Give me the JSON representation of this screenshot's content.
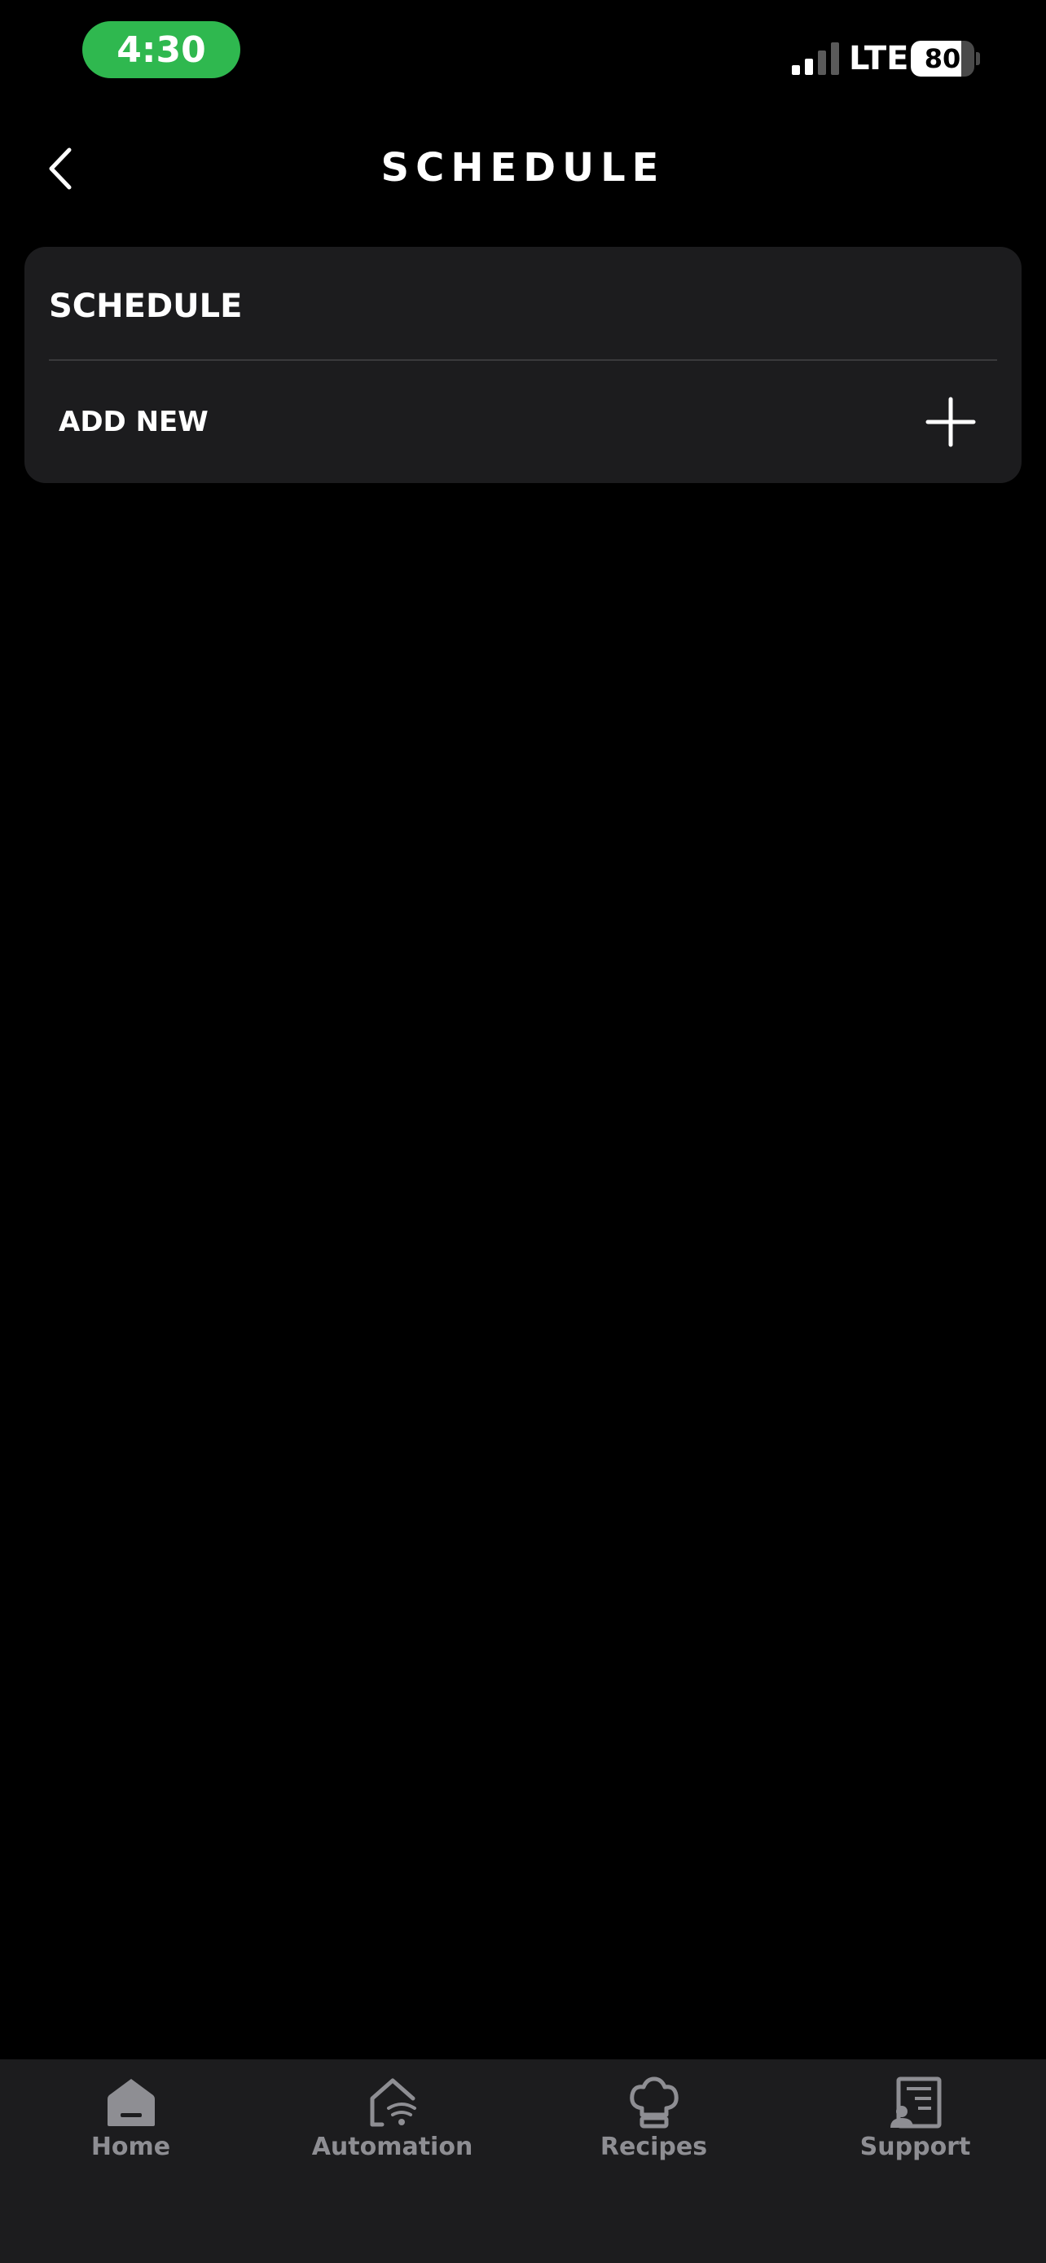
{
  "status_bar": {
    "time": "4:30",
    "carrier": "LTE",
    "battery_percent": 80,
    "battery_label": "80",
    "time_pill_color": "#2fb84f"
  },
  "header": {
    "title": "SCHEDULE",
    "back_icon": "chevron-left-icon"
  },
  "card": {
    "title": "SCHEDULE",
    "add_label": "ADD NEW",
    "add_icon": "plus-icon"
  },
  "tabs": [
    {
      "label": "Home",
      "icon": "home-icon"
    },
    {
      "label": "Automation",
      "icon": "automation-icon"
    },
    {
      "label": "Recipes",
      "icon": "chef-hat-icon"
    },
    {
      "label": "Support",
      "icon": "support-icon"
    }
  ],
  "colors": {
    "background": "#000000",
    "card": "#1c1c1e",
    "tab_inactive": "#8e8e93"
  }
}
